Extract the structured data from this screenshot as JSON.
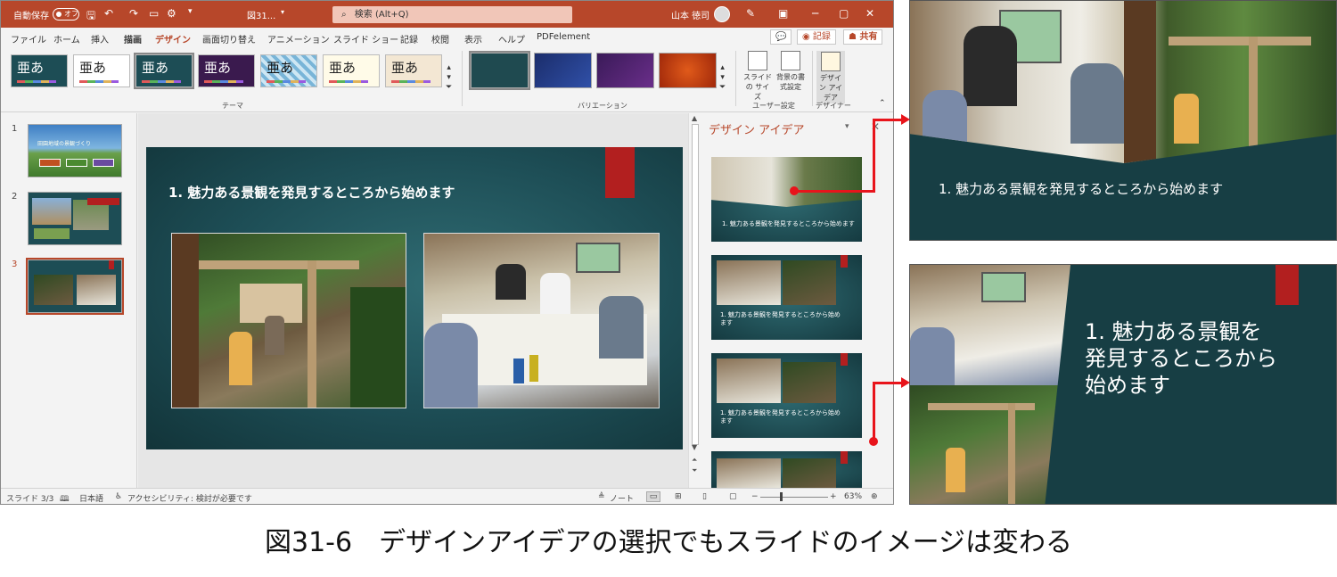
{
  "titlebar": {
    "autosave_label": "自動保存",
    "autosave_state": "オフ",
    "filename": "図31...",
    "search_placeholder": "検索 (Alt+Q)",
    "user_name": "山本 徳司"
  },
  "menu": {
    "tabs": [
      "ファイル",
      "ホーム",
      "挿入",
      "描画",
      "デザイン",
      "画面切り替え",
      "アニメーション",
      "スライド ショー",
      "記録",
      "校閲",
      "表示",
      "ヘルプ",
      "PDFelement"
    ],
    "active_tab": "デザイン",
    "record_label": "記録",
    "share_label": "共有"
  },
  "ribbon": {
    "theme_glyph": "亜あ",
    "group_theme": "テーマ",
    "group_variation": "バリエーション",
    "slide_size_label": "スライドの サイズ",
    "bg_format_label": "背景の書 式設定",
    "group_user": "ユーザー設定",
    "design_ideas_btn": "デザイン アイデア",
    "group_designer": "デザイナー"
  },
  "thumbs": {
    "numbers": [
      "1",
      "2",
      "3"
    ],
    "thumb1_title": "田園地域の景観づくり"
  },
  "slide": {
    "title": "1. 魅力ある景観を発見するところから始めます"
  },
  "design_pane": {
    "header": "デザイン アイデア",
    "idea1_text": "1. 魅力ある景観を発見するところから始めます",
    "idea2_text_line1": "1. 魅力ある景観を発見するところから始め",
    "idea2_text_line2": "ます",
    "idea3_text_line1": "1. 魅力ある景観を発見するところから始め",
    "idea3_text_line2": "ます"
  },
  "status": {
    "slide_info": "スライド 3/3",
    "language": "日本語",
    "accessibility": "アクセシビリティ: 検討が必要です",
    "notes": "ノート",
    "zoom": "63%"
  },
  "preview1": {
    "title": "1. 魅力ある景観を発見するところから始めます"
  },
  "preview2": {
    "title": "1. 魅力ある景観を発見するところから始めます"
  },
  "caption": "図31-6　デザインアイデアの選択でもスライドのイメージは変わる",
  "colors": {
    "accent": "#b7472a",
    "slide_bg": "#1d4d55",
    "slide_accent": "#b21f1f",
    "arrow": "#e8141b"
  }
}
